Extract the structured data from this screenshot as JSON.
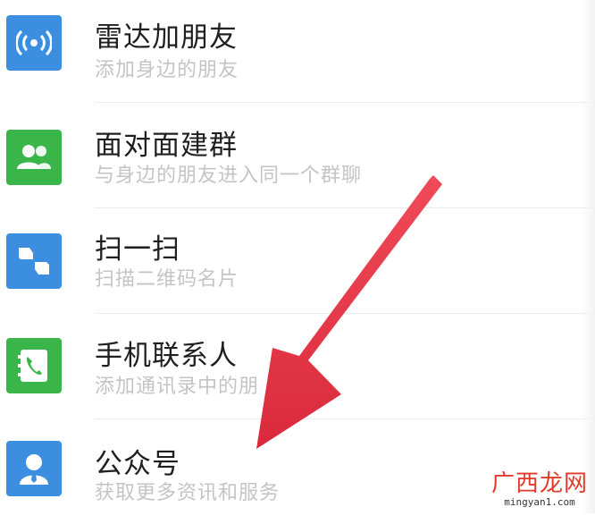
{
  "colors": {
    "blue_icon_bg": "#3b8ee0",
    "green_icon_bg": "#39b54a",
    "arrow_red": "#e8394a",
    "watermark_red": "#e03a2a"
  },
  "items": [
    {
      "title": "雷达加朋友",
      "subtitle": "添加身边的朋友",
      "icon": "radar-icon",
      "icon_color": "#3b8ee0"
    },
    {
      "title": "面对面建群",
      "subtitle": "与身边的朋友进入同一个群聊",
      "icon": "group-people-icon",
      "icon_color": "#39b54a"
    },
    {
      "title": "扫一扫",
      "subtitle": "扫描二维码名片",
      "icon": "scan-icon",
      "icon_color": "#3b8ee0"
    },
    {
      "title": "手机联系人",
      "subtitle": "添加通讯录中的朋",
      "icon": "phone-contacts-icon",
      "icon_color": "#39b54a"
    },
    {
      "title": "公众号",
      "subtitle": "获取更多资讯和服务",
      "icon": "official-account-icon",
      "icon_color": "#3b8ee0"
    }
  ],
  "watermark": {
    "title": "广西龙网",
    "url": "mingyan1.com"
  }
}
